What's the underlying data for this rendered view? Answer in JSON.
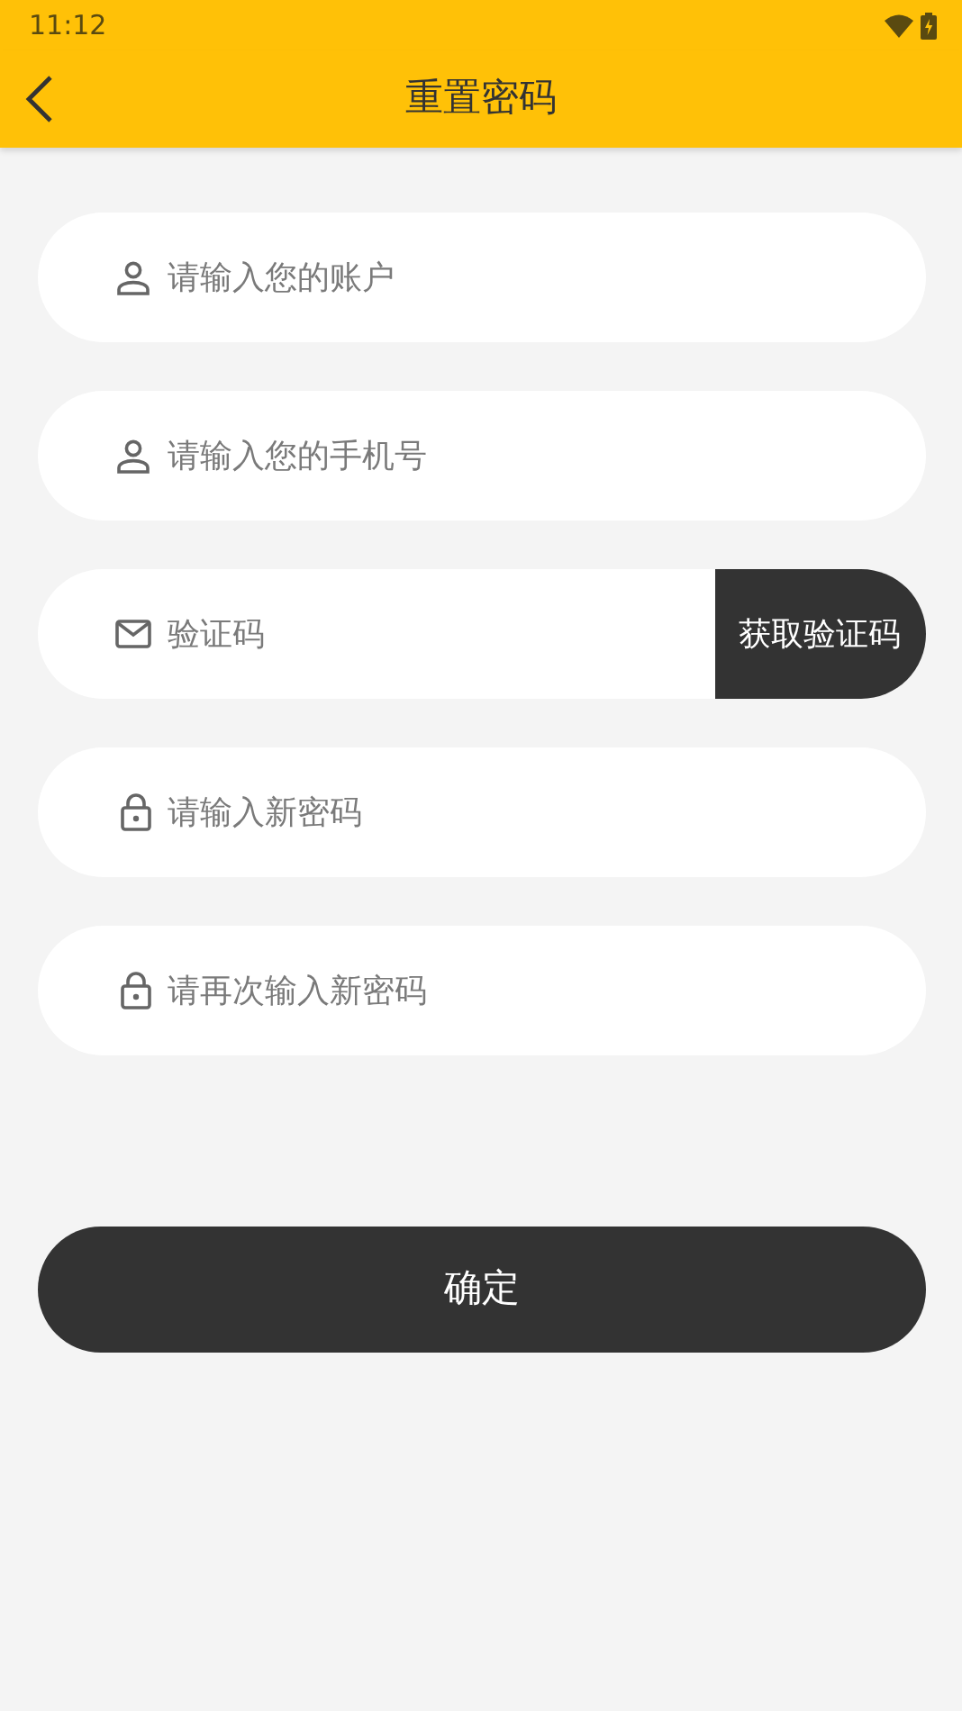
{
  "status_bar": {
    "time": "11:12"
  },
  "toolbar": {
    "title": "重置密码"
  },
  "fields": [
    {
      "kind": "text",
      "placeholder": "请输入您的账户"
    },
    {
      "kind": "text",
      "placeholder": "请输入您的手机号"
    },
    {
      "kind": "code",
      "placeholder": "验证码",
      "button": "获取验证码"
    },
    {
      "kind": "password",
      "placeholder": "请输入新密码"
    },
    {
      "kind": "password",
      "placeholder": "请再次输入新密码"
    }
  ],
  "submit": "确定"
}
